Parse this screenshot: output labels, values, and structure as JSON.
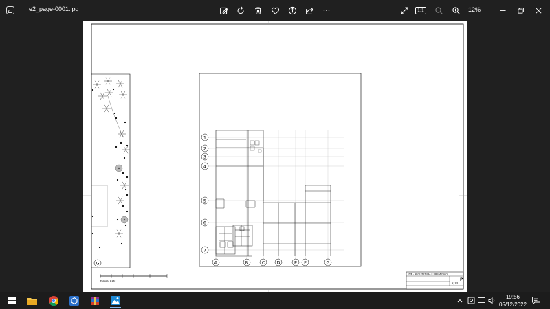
{
  "window": {
    "file_name": "e2_page-0001.jpg",
    "zoom": "12%"
  },
  "toolbar": {
    "icons": [
      "edit-image-icon",
      "rotate-icon",
      "delete-icon",
      "favorite-icon",
      "info-icon",
      "share-icon",
      "more-icon"
    ],
    "right_icons": [
      "fullscreen-icon",
      "actual-size-icon",
      "zoom-out-icon",
      "zoom-in-icon"
    ],
    "actual_size_label": "1:1",
    "more_label": "···"
  },
  "drawing": {
    "row_labels": [
      "1",
      "2",
      "3",
      "4",
      "5",
      "6",
      "7"
    ],
    "col_labels": [
      "A",
      "B",
      "C",
      "D",
      "E",
      "F",
      "G"
    ],
    "left_col_label": "G",
    "scale_caption": "ESCALA: 1:250",
    "title_block": {
      "heading": "UVA - ARQUITETURA E URBANISMO",
      "sheet": "P",
      "sheet_no": "2/10"
    }
  },
  "taskbar": {
    "apps": [
      "windows-start-icon",
      "file-explorer-icon",
      "chrome-icon",
      "app-blue-icon",
      "winrar-icon",
      "photos-icon"
    ],
    "time": "19:56",
    "date": "05/12/2022"
  }
}
